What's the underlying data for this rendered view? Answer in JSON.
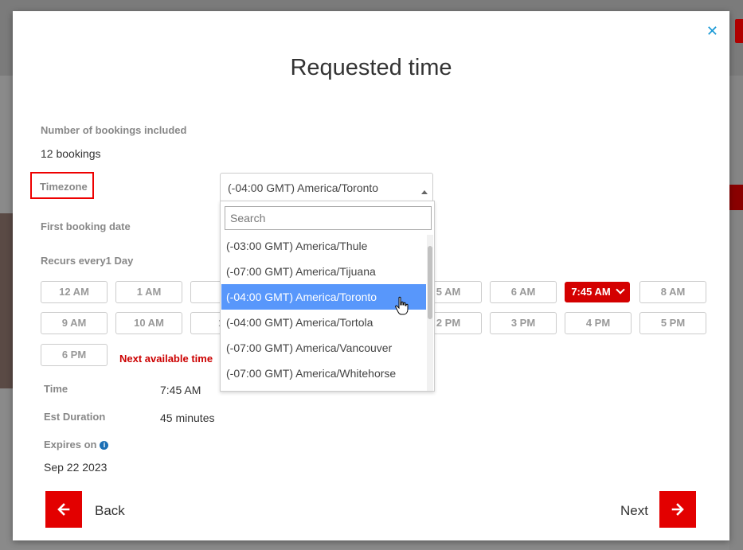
{
  "modal": {
    "title": "Requested time",
    "close_icon": "close-icon"
  },
  "fields": {
    "bookings_label": "Number of bookings included",
    "bookings_value": "12 bookings",
    "timezone_label": "Timezone",
    "first_date_label": "First booking date",
    "recurs_label": "Recurs every1 Day",
    "time_label": "Time",
    "time_value": "7:45 AM",
    "duration_label": "Est Duration",
    "duration_value": "45 minutes",
    "expires_label": "Expires on",
    "expires_value": "Sep 22 2023"
  },
  "timezone_select": {
    "selected": "(-04:00 GMT) America/Toronto",
    "search_placeholder": "Search",
    "options": [
      "(-03:00 GMT) America/Thule",
      "(-07:00 GMT) America/Tijuana",
      "(-04:00 GMT) America/Toronto",
      "(-04:00 GMT) America/Tortola",
      "(-07:00 GMT) America/Vancouver",
      "(-07:00 GMT) America/Whitehorse"
    ],
    "highlighted_index": 2
  },
  "time_slots": {
    "row1": [
      "12 AM",
      "1 AM",
      "2",
      "5 AM",
      "6 AM",
      "7:45 AM",
      "8 AM"
    ],
    "row2": [
      "9 AM",
      "10 AM",
      "11",
      "2 PM",
      "3 PM",
      "4 PM",
      "5 PM"
    ],
    "row3": [
      "6 PM"
    ],
    "selected": "7:45 AM",
    "next_available": "Next available time"
  },
  "footer": {
    "back_label": "Back",
    "next_label": "Next"
  },
  "colors": {
    "accent": "#e30000",
    "highlight": "#5897fb",
    "close": "#1b9ad6"
  }
}
